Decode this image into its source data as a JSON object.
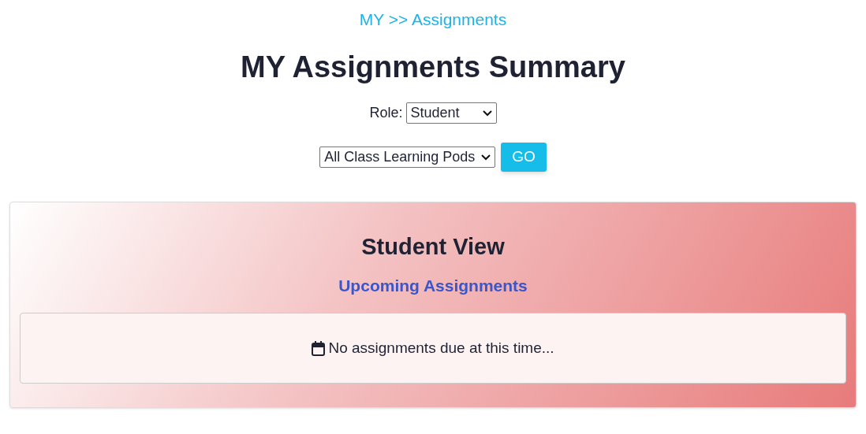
{
  "breadcrumb": "MY >> Assignments",
  "title": "MY Assignments Summary",
  "role_filter": {
    "label": "Role:",
    "value": "Student"
  },
  "pod_filter": {
    "value": "All Class Learning Pods"
  },
  "go_button": "GO",
  "panel": {
    "title": "Student View",
    "subtitle": "Upcoming Assignments",
    "empty_message": "No assignments due at this time..."
  }
}
